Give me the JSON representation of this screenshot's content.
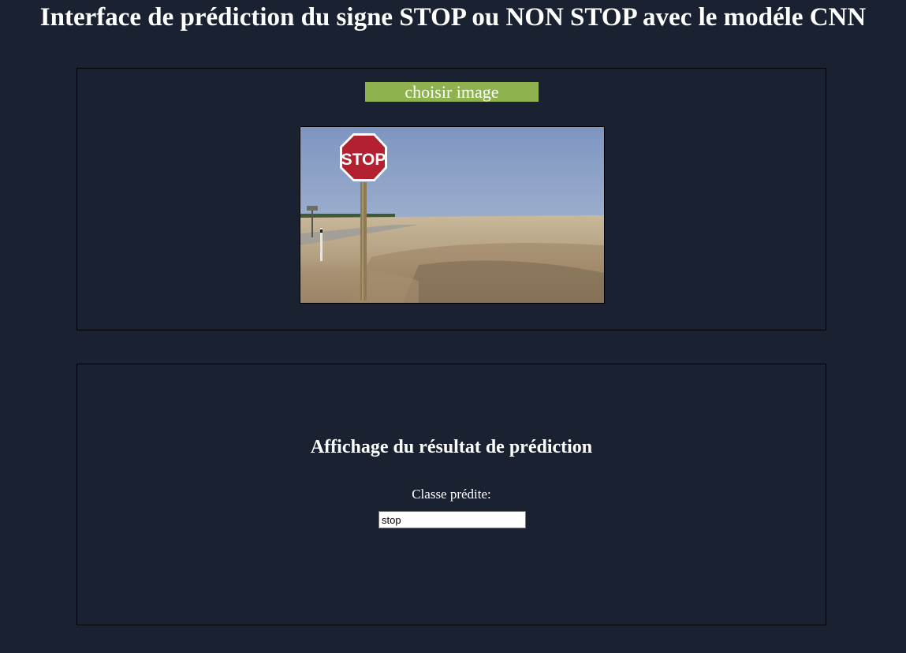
{
  "header": {
    "title": "Interface de prédiction du signe STOP ou NON STOP avec le modéle CNN"
  },
  "upload": {
    "button_label": "choisir image",
    "preview_image_icon": "stop-sign-photo",
    "sign_text": "STOP"
  },
  "result": {
    "heading": "Affichage du résultat de prédiction",
    "class_label": "Classe prédite:",
    "class_value": "stop"
  },
  "colors": {
    "background": "#1a2231",
    "button": "#8db24e",
    "text": "#ffffff",
    "sign_red": "#b3202f"
  }
}
